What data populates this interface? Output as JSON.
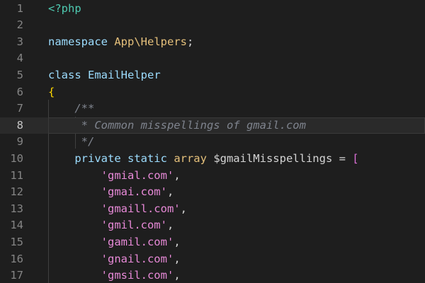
{
  "colors": {
    "background": "#1e1e1e",
    "line_number": "#858585",
    "line_number_active": "#c6c6c6",
    "keyword": "#9cdcfe",
    "tag": "#4ec9b0",
    "class_name": "#e5c07b",
    "plain": "#d4d4d4",
    "comment": "#7f848e",
    "string": "#e88ad8",
    "brace": "#ffd700",
    "bracket": "#da70d6"
  },
  "editor": {
    "current_line": 8,
    "lines": [
      {
        "number": "1",
        "tokens": [
          {
            "text": "<?php",
            "kind": "tag"
          }
        ]
      },
      {
        "number": "2",
        "tokens": []
      },
      {
        "number": "3",
        "tokens": [
          {
            "text": "namespace ",
            "kind": "keyword"
          },
          {
            "text": "App\\Helpers",
            "kind": "class_name"
          },
          {
            "text": ";",
            "kind": "plain"
          }
        ]
      },
      {
        "number": "4",
        "tokens": []
      },
      {
        "number": "5",
        "tokens": [
          {
            "text": "class ",
            "kind": "keyword"
          },
          {
            "text": "EmailHelper",
            "kind": "keyword"
          }
        ]
      },
      {
        "number": "6",
        "tokens": [
          {
            "text": "{",
            "kind": "brace"
          }
        ]
      },
      {
        "number": "7",
        "tokens": [
          {
            "text": "    /**",
            "kind": "comment"
          }
        ]
      },
      {
        "number": "8",
        "tokens": [
          {
            "text": "     * Common misspellings of gmail.com",
            "kind": "comment"
          }
        ]
      },
      {
        "number": "9",
        "tokens": [
          {
            "text": "     */",
            "kind": "comment"
          }
        ]
      },
      {
        "number": "10",
        "tokens": [
          {
            "text": "    private static ",
            "kind": "keyword"
          },
          {
            "text": "array ",
            "kind": "class_name"
          },
          {
            "text": "$gmailMisspellings = ",
            "kind": "plain"
          },
          {
            "text": "[",
            "kind": "bracket"
          }
        ]
      },
      {
        "number": "11",
        "tokens": [
          {
            "text": "        'gmial.com'",
            "kind": "string"
          },
          {
            "text": ",",
            "kind": "plain"
          }
        ]
      },
      {
        "number": "12",
        "tokens": [
          {
            "text": "        'gmai.com'",
            "kind": "string"
          },
          {
            "text": ",",
            "kind": "plain"
          }
        ]
      },
      {
        "number": "13",
        "tokens": [
          {
            "text": "        'gmaill.com'",
            "kind": "string"
          },
          {
            "text": ",",
            "kind": "plain"
          }
        ]
      },
      {
        "number": "14",
        "tokens": [
          {
            "text": "        'gmil.com'",
            "kind": "string"
          },
          {
            "text": ",",
            "kind": "plain"
          }
        ]
      },
      {
        "number": "15",
        "tokens": [
          {
            "text": "        'gamil.com'",
            "kind": "string"
          },
          {
            "text": ",",
            "kind": "plain"
          }
        ]
      },
      {
        "number": "16",
        "tokens": [
          {
            "text": "        'gnail.com'",
            "kind": "string"
          },
          {
            "text": ",",
            "kind": "plain"
          }
        ]
      },
      {
        "number": "17",
        "tokens": [
          {
            "text": "        'gmsil.com'",
            "kind": "string"
          },
          {
            "text": ",",
            "kind": "plain"
          }
        ]
      }
    ]
  }
}
